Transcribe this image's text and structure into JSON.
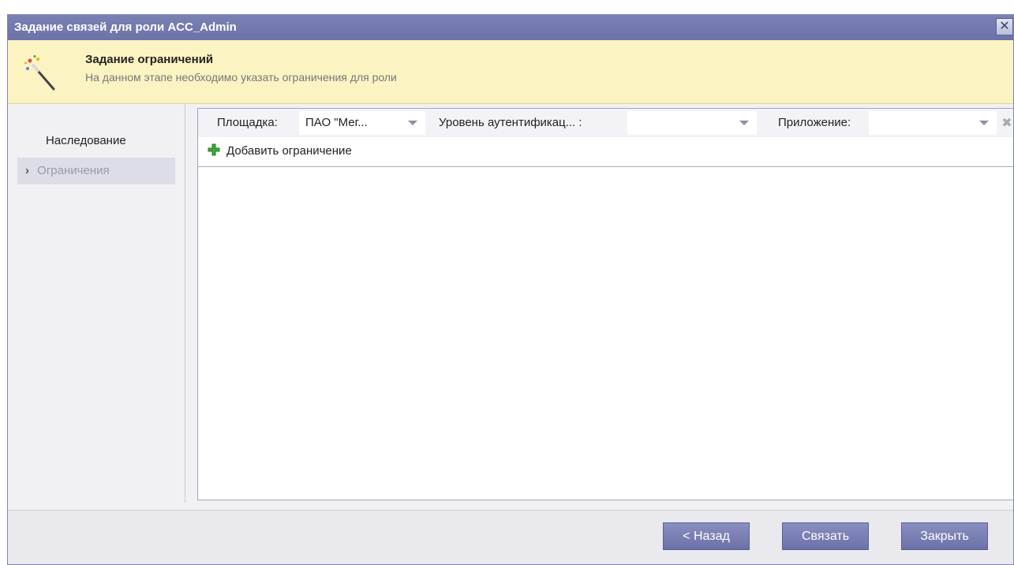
{
  "window": {
    "title": "Задание связей для роли ACC_Admin",
    "close_glyph": "✕"
  },
  "banner": {
    "icon": "magic-wand-icon",
    "title": "Задание ограничений",
    "subtitle": "На данном этапе необходимо указать ограничения для роли"
  },
  "nav": {
    "items": [
      {
        "label": "Наследование",
        "active": false
      },
      {
        "label": "Ограничения",
        "active": true,
        "marker": "›"
      }
    ]
  },
  "filters": {
    "site_label": "Площадка:",
    "site_value": "ПАО \"Мег...",
    "auth_label": "Уровень аутентификац... :",
    "auth_value": "",
    "app_label": "Приложение:",
    "app_value": "",
    "clear_glyph": "✖"
  },
  "toolbar": {
    "add_label": "Добавить ограничение",
    "add_icon": "plus-icon"
  },
  "footer": {
    "back_label": "< Назад",
    "link_label": "Связать",
    "close_label": "Закрыть"
  },
  "colors": {
    "titlebar": "#6d73a8",
    "banner": "#fbf3c2",
    "button": "#7379ae",
    "plus": "#3aa83a"
  }
}
